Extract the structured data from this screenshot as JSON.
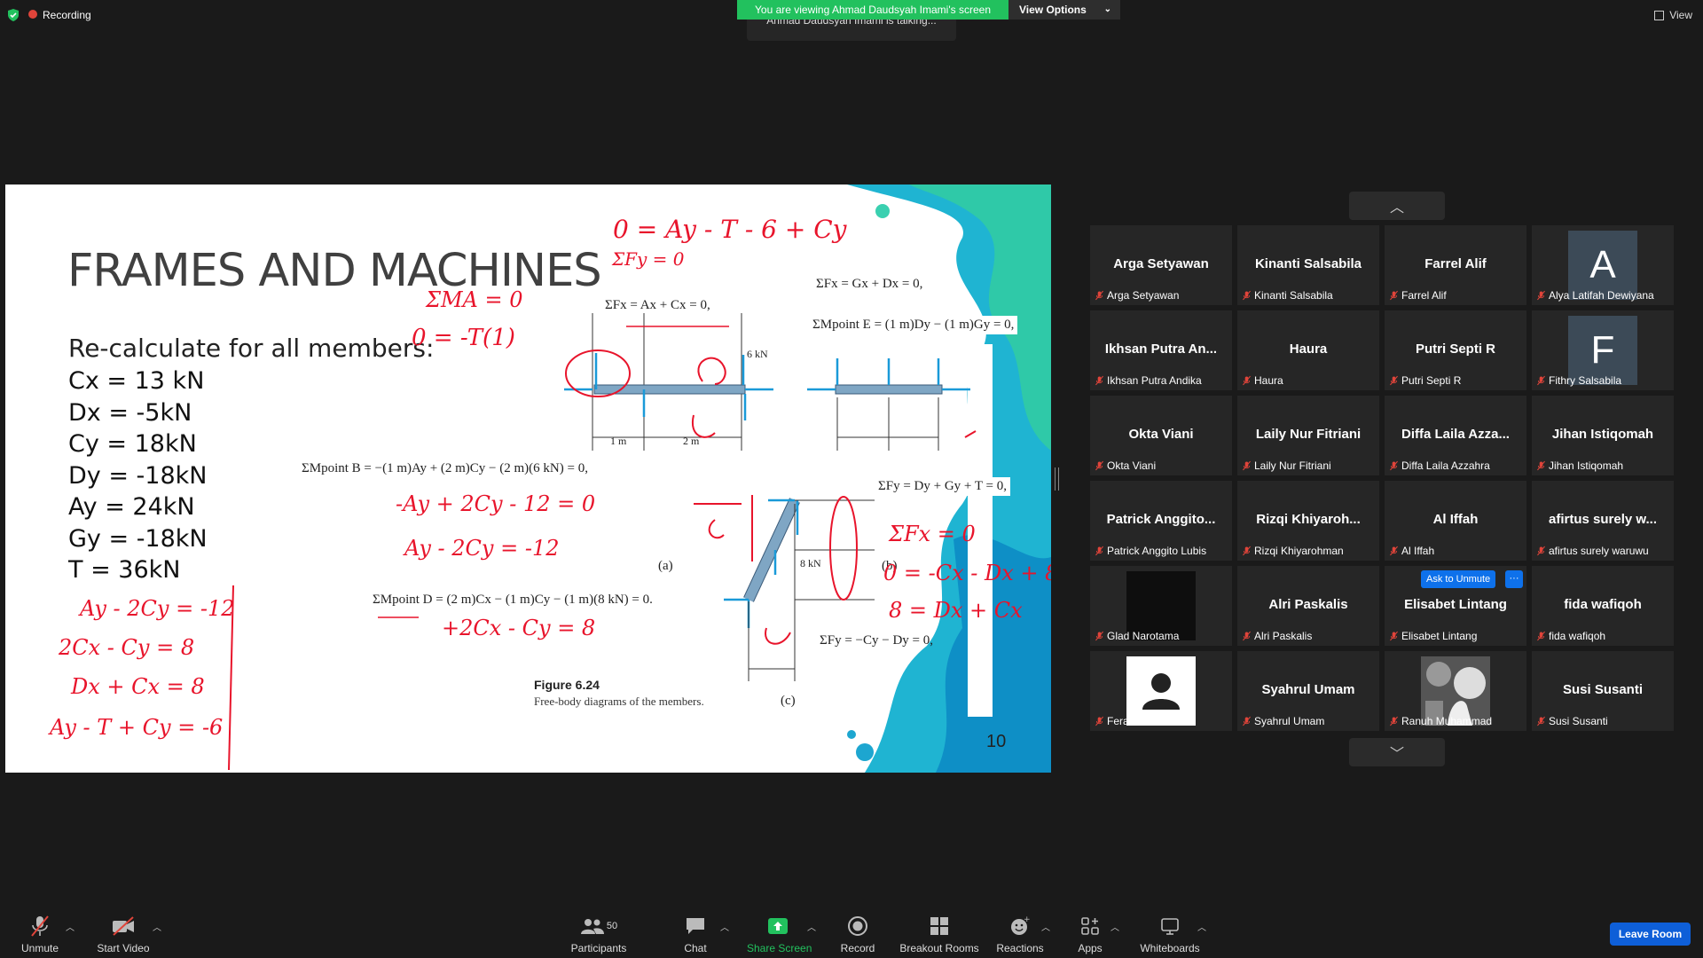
{
  "top": {
    "recording_label": "Recording",
    "banner_text": "You are viewing Ahmad Daudsyah Imami's screen",
    "view_options_label": "View Options",
    "talking_text": "Ahmad Daudsyah Imami is talking...",
    "view_label": "View"
  },
  "slide": {
    "title": "FRAMES AND MACHINES",
    "subtitle": "Re-calculate for all members:",
    "values": [
      "Cx = 13 kN",
      "Dx = -5kN",
      "Cy = 18kN",
      "Dy = -18kN",
      "Ay = 24kN",
      "Gy = -18kN",
      "T = 36kN"
    ],
    "figure_title": "Figure 6.24",
    "figure_caption": "Free-body diagrams of the members.",
    "page_number": "10",
    "equations": {
      "sum_fx_a": "ΣFx = Ax + Cx = 0,",
      "sum_fx_g": "ΣFx = Gx + Dx = 0,",
      "sum_m_e": "ΣMpoint E = (1 m)Dy − (1 m)Gy = 0,",
      "sum_m_b": "ΣMpoint B = −(1 m)Ay + (2 m)Cy − (2 m)(6 kN) = 0,",
      "sum_fy_d": "ΣFy = Dy + Gy + T = 0,",
      "sum_m_d": "ΣMpoint D = (2 m)Cx − (1 m)Cy − (1 m)(8 kN) = 0.",
      "sum_fy_c": "ΣFy = −Cy − Dy = 0,"
    },
    "diagram_labels": {
      "a": "(a)",
      "b": "(b)",
      "c": "(c)",
      "six_kn": "6 kN",
      "eight_kn": "8 kN",
      "one_m": "1 m",
      "two_m": "2 m"
    },
    "handwriting": {
      "h1": "0 = Ay - T - 6 + Cy",
      "h2": "ΣFy = 0",
      "h3": "ΣMA = 0",
      "h4": "0 = -T(1)",
      "h5": "-Ay + 2Cy - 12 = 0",
      "h6": "Ay - 2Cy = -12",
      "h7": "+2Cx - Cy = 8",
      "h8": "ΣFx = 0",
      "h9": "0 = -Cx - Dx + 8",
      "h10": "8 = Dx + Cx",
      "h11": "Ay - 2Cy = -12",
      "h12": "2Cx - Cy = 8",
      "h13": "Dx + Cx = 8",
      "h14": "Ay - T + Cy = -6"
    }
  },
  "participants": [
    {
      "display": "Arga Setyawan",
      "label": "Arga Setyawan"
    },
    {
      "display": "Kinanti Salsabila",
      "label": "Kinanti Salsabila"
    },
    {
      "display": "Farrel Alif",
      "label": "Farrel Alif"
    },
    {
      "display": "A",
      "label": "Alya Latifah Dewiyana"
    },
    {
      "display": "Ikhsan Putra An...",
      "label": "Ikhsan Putra Andika"
    },
    {
      "display": "Haura",
      "label": "Haura"
    },
    {
      "display": "Putri Septi R",
      "label": "Putri Septi R"
    },
    {
      "display": "F",
      "label": "Fithry Salsabila"
    },
    {
      "display": "Okta Viani",
      "label": "Okta Viani"
    },
    {
      "display": "Laily Nur Fitriani",
      "label": "Laily Nur Fitriani"
    },
    {
      "display": "Diffa Laila Azza...",
      "label": "Diffa Laila Azzahra"
    },
    {
      "display": "Jihan Istiqomah",
      "label": "Jihan Istiqomah"
    },
    {
      "display": "Patrick  Anggito...",
      "label": "Patrick Anggito Lubis"
    },
    {
      "display": "Rizqi  Khiyaroh...",
      "label": "Rizqi Khiyarohman"
    },
    {
      "display": "Al Iffah",
      "label": "Al Iffah"
    },
    {
      "display": "afirtus surely w...",
      "label": "afirtus surely waruwu"
    },
    {
      "display": "",
      "label": "Glad Narotama"
    },
    {
      "display": "Alri Paskalis",
      "label": "Alri Paskalis"
    },
    {
      "display": "Elisabet Lintang",
      "label": "Elisabet Lintang"
    },
    {
      "display": "fida wafiqoh",
      "label": "fida wafiqoh"
    },
    {
      "display": "",
      "label": "Ferarista Irawan"
    },
    {
      "display": "Syahrul Umam",
      "label": "Syahrul Umam"
    },
    {
      "display": "",
      "label": "Ranuh Muhammad"
    },
    {
      "display": "Susi Susanti",
      "label": "Susi Susanti"
    }
  ],
  "ask_to_unmute": "Ask to Unmute",
  "more_label": "···",
  "toolbar": {
    "unmute": "Unmute",
    "start_video": "Start Video",
    "participants": "Participants",
    "participants_count": "50",
    "chat": "Chat",
    "share_screen": "Share Screen",
    "record": "Record",
    "breakout_rooms": "Breakout Rooms",
    "reactions": "Reactions",
    "apps": "Apps",
    "whiteboards": "Whiteboards",
    "leave_room": "Leave Room"
  },
  "colors": {
    "share_green": "#22c15e",
    "leave_blue": "#0e5fd8",
    "ink_red": "#e8142b",
    "member_blue": "#7fa6c4"
  }
}
